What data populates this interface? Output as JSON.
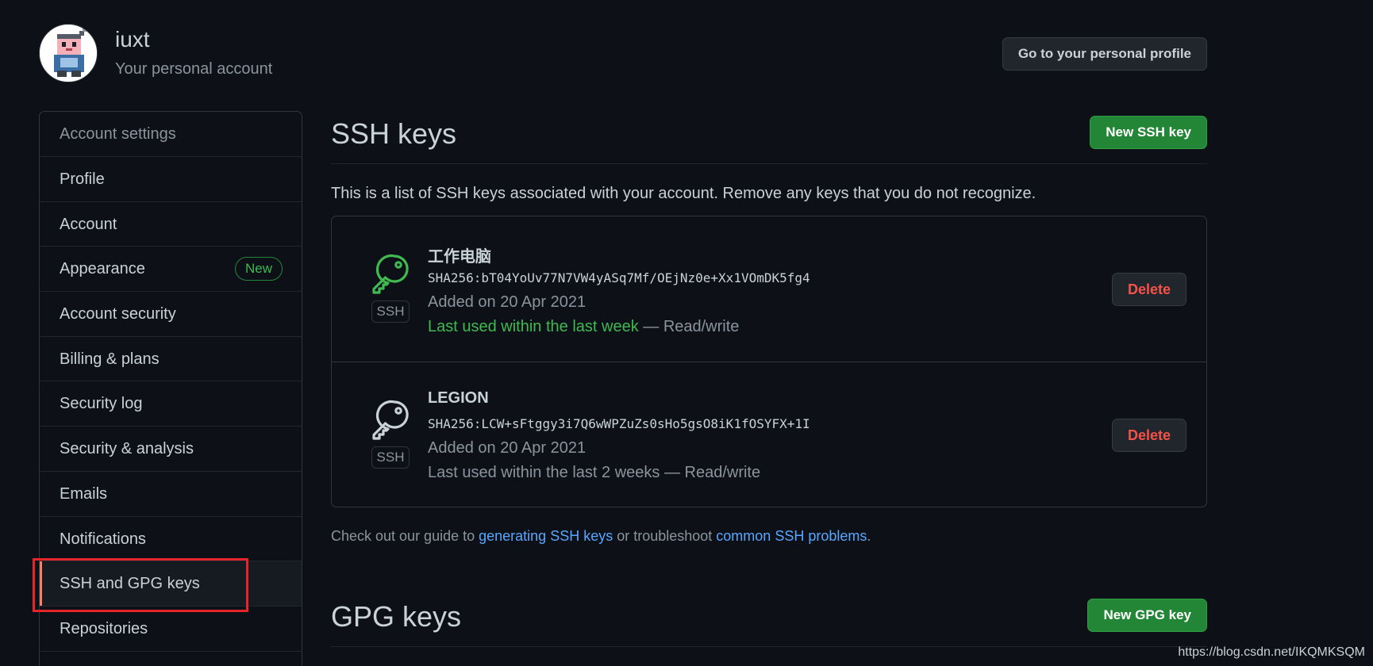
{
  "header": {
    "username": "iuxt",
    "subtitle": "Your personal account",
    "profile_button": "Go to your personal profile"
  },
  "sidebar": {
    "heading": "Account settings",
    "items": [
      {
        "label": "Profile"
      },
      {
        "label": "Account"
      },
      {
        "label": "Appearance",
        "badge": "New"
      },
      {
        "label": "Account security"
      },
      {
        "label": "Billing & plans"
      },
      {
        "label": "Security log"
      },
      {
        "label": "Security & analysis"
      },
      {
        "label": "Emails"
      },
      {
        "label": "Notifications"
      },
      {
        "label": "SSH and GPG keys",
        "active": true
      },
      {
        "label": "Repositories"
      }
    ]
  },
  "ssh": {
    "title": "SSH keys",
    "new_button": "New SSH key",
    "description": "This is a list of SSH keys associated with your account. Remove any keys that you do not recognize.",
    "keys": [
      {
        "title": "工作电脑",
        "fingerprint": "SHA256:bT04YoUv77N7VW4yASq7Mf/OEjNz0e+Xx1VOmDK5fg4",
        "added": "Added on 20 Apr 2021",
        "last_used": "Last used within the last week",
        "access": " — Read/write",
        "type_label": "SSH",
        "delete_label": "Delete",
        "icon_color": "#3fb950"
      },
      {
        "title": "LEGION",
        "fingerprint": "SHA256:LCW+sFtggy3i7Q6wWPZuZs0sHo5gsO8iK1fOSYFX+1I",
        "added": "Added on 20 Apr 2021",
        "last_used": "Last used within the last 2 weeks",
        "access": " — Read/write",
        "type_label": "SSH",
        "delete_label": "Delete",
        "icon_color": "#c9d1d9"
      }
    ],
    "guide": {
      "prefix": "Check out our guide to ",
      "link1": "generating SSH keys",
      "middle": " or troubleshoot ",
      "link2": "common SSH problems",
      "suffix": "."
    }
  },
  "gpg": {
    "title": "GPG keys",
    "new_button": "New GPG key"
  },
  "watermark": "https://blog.csdn.net/IKQMKSQM",
  "colors": {
    "background": "#0d1117",
    "accent_green": "#238636",
    "danger": "#f85149",
    "link": "#58a6ff",
    "highlight_box": "#e5252a"
  }
}
